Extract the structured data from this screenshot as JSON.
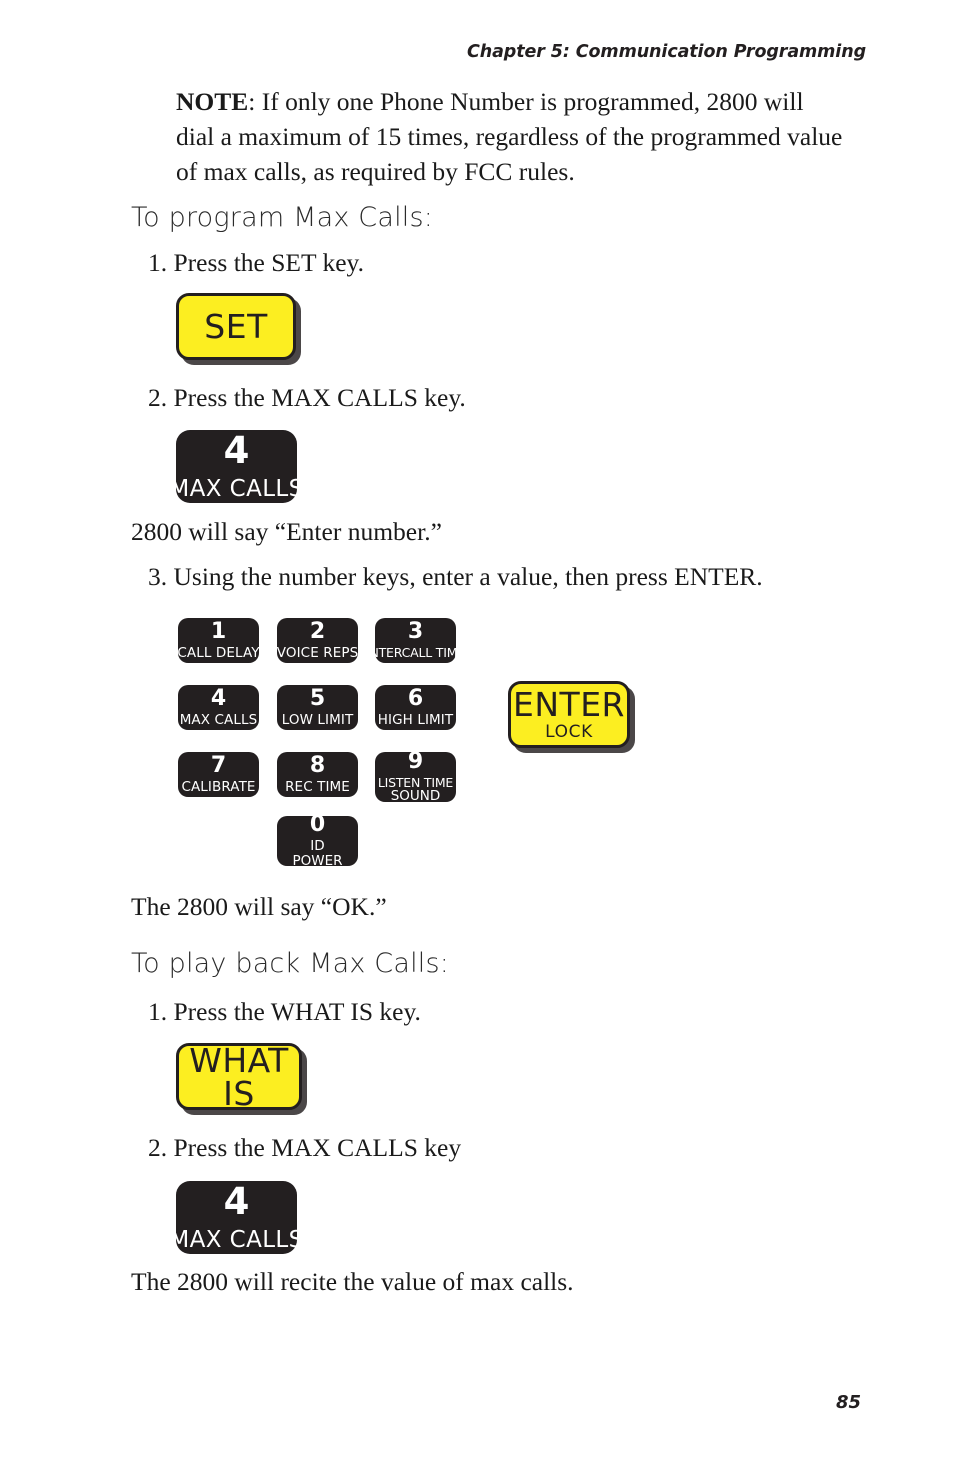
{
  "header": {
    "chapter_title": "Chapter 5: Communication Programming"
  },
  "note": {
    "label": "NOTE",
    "text": ": If only one Phone Number is programmed, 2800 will dial a maximum of 15 times, regardless of the programmed value of max calls, as required by FCC rules."
  },
  "sections": [
    {
      "heading": "To program Max Calls:",
      "steps": [
        "1. Press the SET key.",
        "2. Press the MAX CALLS key.",
        "3. Using the number keys, enter a value, then press ENTER."
      ],
      "notes": [
        "2800 will say “Enter number.”",
        "The 2800 will say “OK.”"
      ]
    },
    {
      "heading": "To play back Max Calls:",
      "steps": [
        "1. Press the WHAT IS key.",
        "2. Press the MAX CALLS key"
      ],
      "notes": [
        "The 2800 will recite the value of max calls."
      ]
    }
  ],
  "keys": {
    "set": {
      "main": "SET",
      "sub": ""
    },
    "enter": {
      "main": "ENTER",
      "sub": "LOCK"
    },
    "what_is": {
      "main": "WHAT IS",
      "sub": ""
    },
    "max_calls_1": {
      "main": "4",
      "sub": "MAX CALLS"
    },
    "max_calls_2": {
      "main": "4",
      "sub": "MAX CALLS"
    }
  },
  "keypad": [
    {
      "main": "1",
      "sub": "CALL DELAY",
      "sub2": ""
    },
    {
      "main": "2",
      "sub": "VOICE REPS",
      "sub2": ""
    },
    {
      "main": "3",
      "sub": "INTERCALL TIME",
      "sub2": ""
    },
    {
      "main": "4",
      "sub": "MAX CALLS",
      "sub2": ""
    },
    {
      "main": "5",
      "sub": "LOW LIMIT",
      "sub2": ""
    },
    {
      "main": "6",
      "sub": "HIGH LIMIT",
      "sub2": ""
    },
    {
      "main": "7",
      "sub": "CALIBRATE",
      "sub2": ""
    },
    {
      "main": "8",
      "sub": "REC TIME",
      "sub2": ""
    },
    {
      "main": "9",
      "sub": "LISTEN TIME",
      "sub2": "SOUND"
    },
    {
      "main": "0",
      "sub": "ID",
      "sub2": "POWER"
    }
  ],
  "folio": "85",
  "colors": {
    "key_yellow": "#fcee21",
    "key_black": "#231f20",
    "text": "#1a1a1a"
  }
}
